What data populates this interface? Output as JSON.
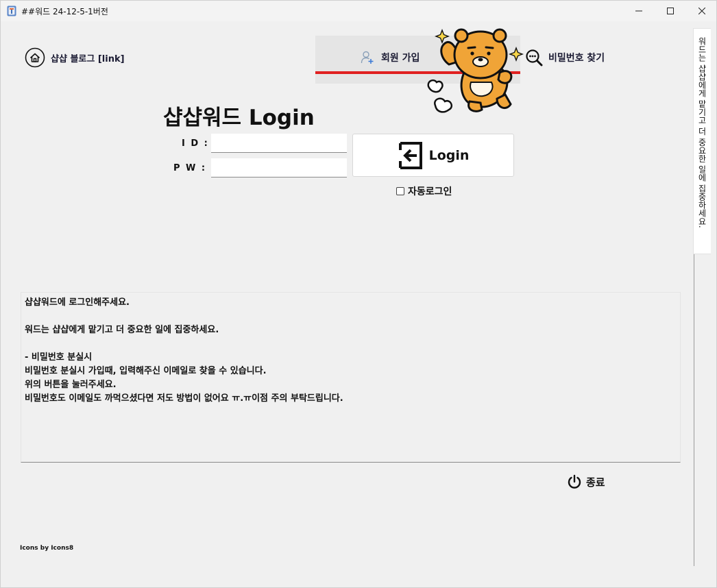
{
  "window": {
    "title": "##워드 24-12-5-1버전"
  },
  "header": {
    "blog_label": "샵샵 블로그 [link]",
    "register_label": "회원 가입",
    "find_password_label": "비밀번호 찾기",
    "accent_color": "#e02020"
  },
  "side_tab": {
    "text": "워드는 샵샵에게 맡기고 더 중요한 일에 집중하세요."
  },
  "login": {
    "title": "샵샵워드 Login",
    "id_label": "I D :",
    "pw_label": "P W :",
    "id_value": "",
    "pw_value": "",
    "button_label": "Login",
    "autologin_label": "자동로그인",
    "autologin_checked": false
  },
  "message": {
    "lines": [
      "샵샵워드에 로그인해주세요.",
      "",
      "워드는 샵샵에게 맡기고 더 중요한 일에 집중하세요.",
      "",
      "- 비밀번호 분실시",
      "비밀번호 분실시 가입때, 입력해주신 이메일로 찾을 수 있습니다.",
      "위의 버튼을 눌러주세요.",
      "비밀번호도 이메일도 까먹으셨다면 저도 방법이 없어요 ㅠ.ㅠ이점 주의 부탁드립니다."
    ]
  },
  "footer": {
    "exit_label": "종료",
    "credit": "Icons by Icons8"
  },
  "icons": {
    "app": "app-icon",
    "home": "home-icon",
    "register": "add-user-icon",
    "find_password": "key-search-icon",
    "login": "login-arrow-icon",
    "exit": "power-icon"
  }
}
